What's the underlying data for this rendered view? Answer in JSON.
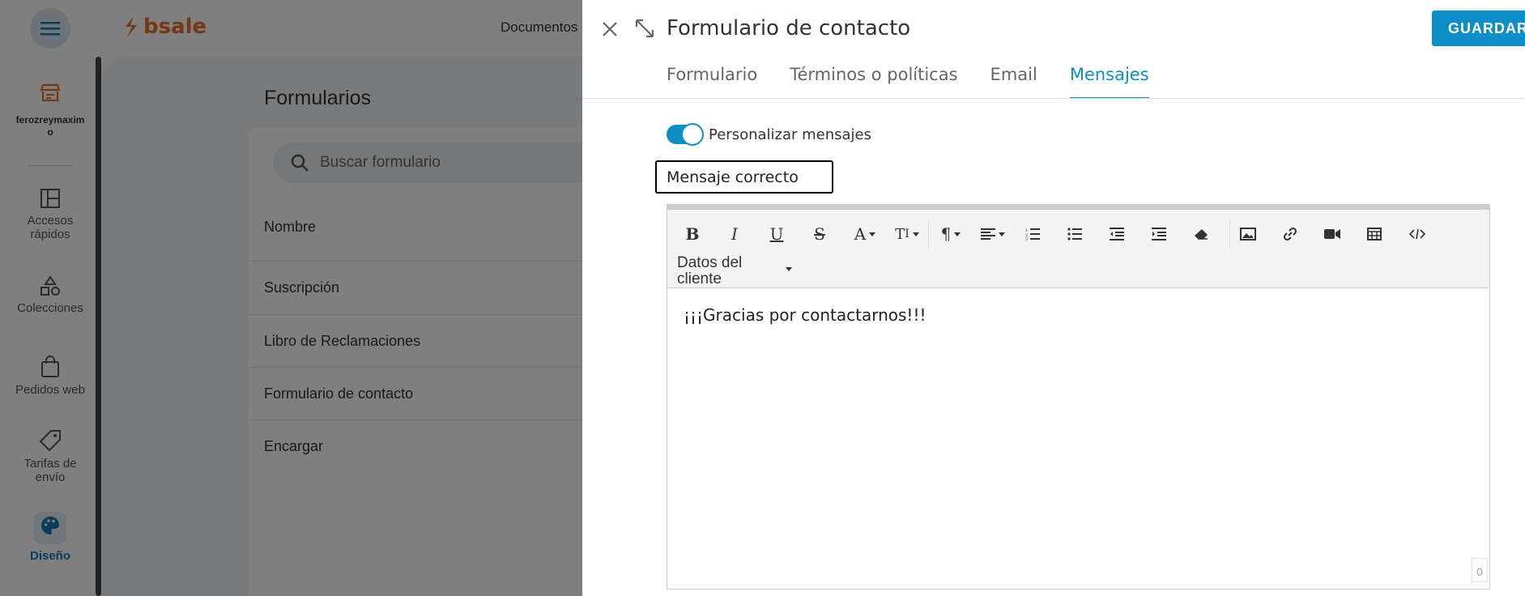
{
  "app": {
    "logo_text": "bsale",
    "top_menu_label": "Documentos",
    "store_name": "ferozreymaximo",
    "nav": [
      {
        "label": "Accesos rápidos",
        "icon": "layout-icon"
      },
      {
        "label": "Colecciones",
        "icon": "shapes-icon"
      },
      {
        "label": "Pedidos web",
        "icon": "shopping-bag-icon"
      },
      {
        "label": "Tarifas de envío",
        "icon": "tag-icon"
      },
      {
        "label": "Diseño",
        "icon": "palette-icon",
        "active": true
      }
    ]
  },
  "forms_page": {
    "title": "Formularios",
    "search_placeholder": "Buscar formulario",
    "column_header": "Nombre",
    "rows": [
      "Suscripción",
      "Libro de Reclamaciones",
      "Formulario de contacto",
      "Encargar"
    ]
  },
  "drawer": {
    "title": "Formulario de contacto",
    "save_label": "GUARDAR",
    "tabs": [
      {
        "label": "Formulario"
      },
      {
        "label": "Términos o políticas"
      },
      {
        "label": "Email"
      },
      {
        "label": "Mensajes",
        "active": true
      }
    ],
    "toggle_label": "Personalizar mensajes",
    "toggle_on": true,
    "message_type": "Mensaje correcto",
    "editor": {
      "client_data_label": "Datos del cliente",
      "content": "¡¡¡Gracias por contactarnos!!!",
      "char_counter": "0"
    }
  },
  "colors": {
    "accent": "#0e8ec7",
    "brand": "#e8702a",
    "overlay": "rgba(0,0,0,0.5)"
  }
}
